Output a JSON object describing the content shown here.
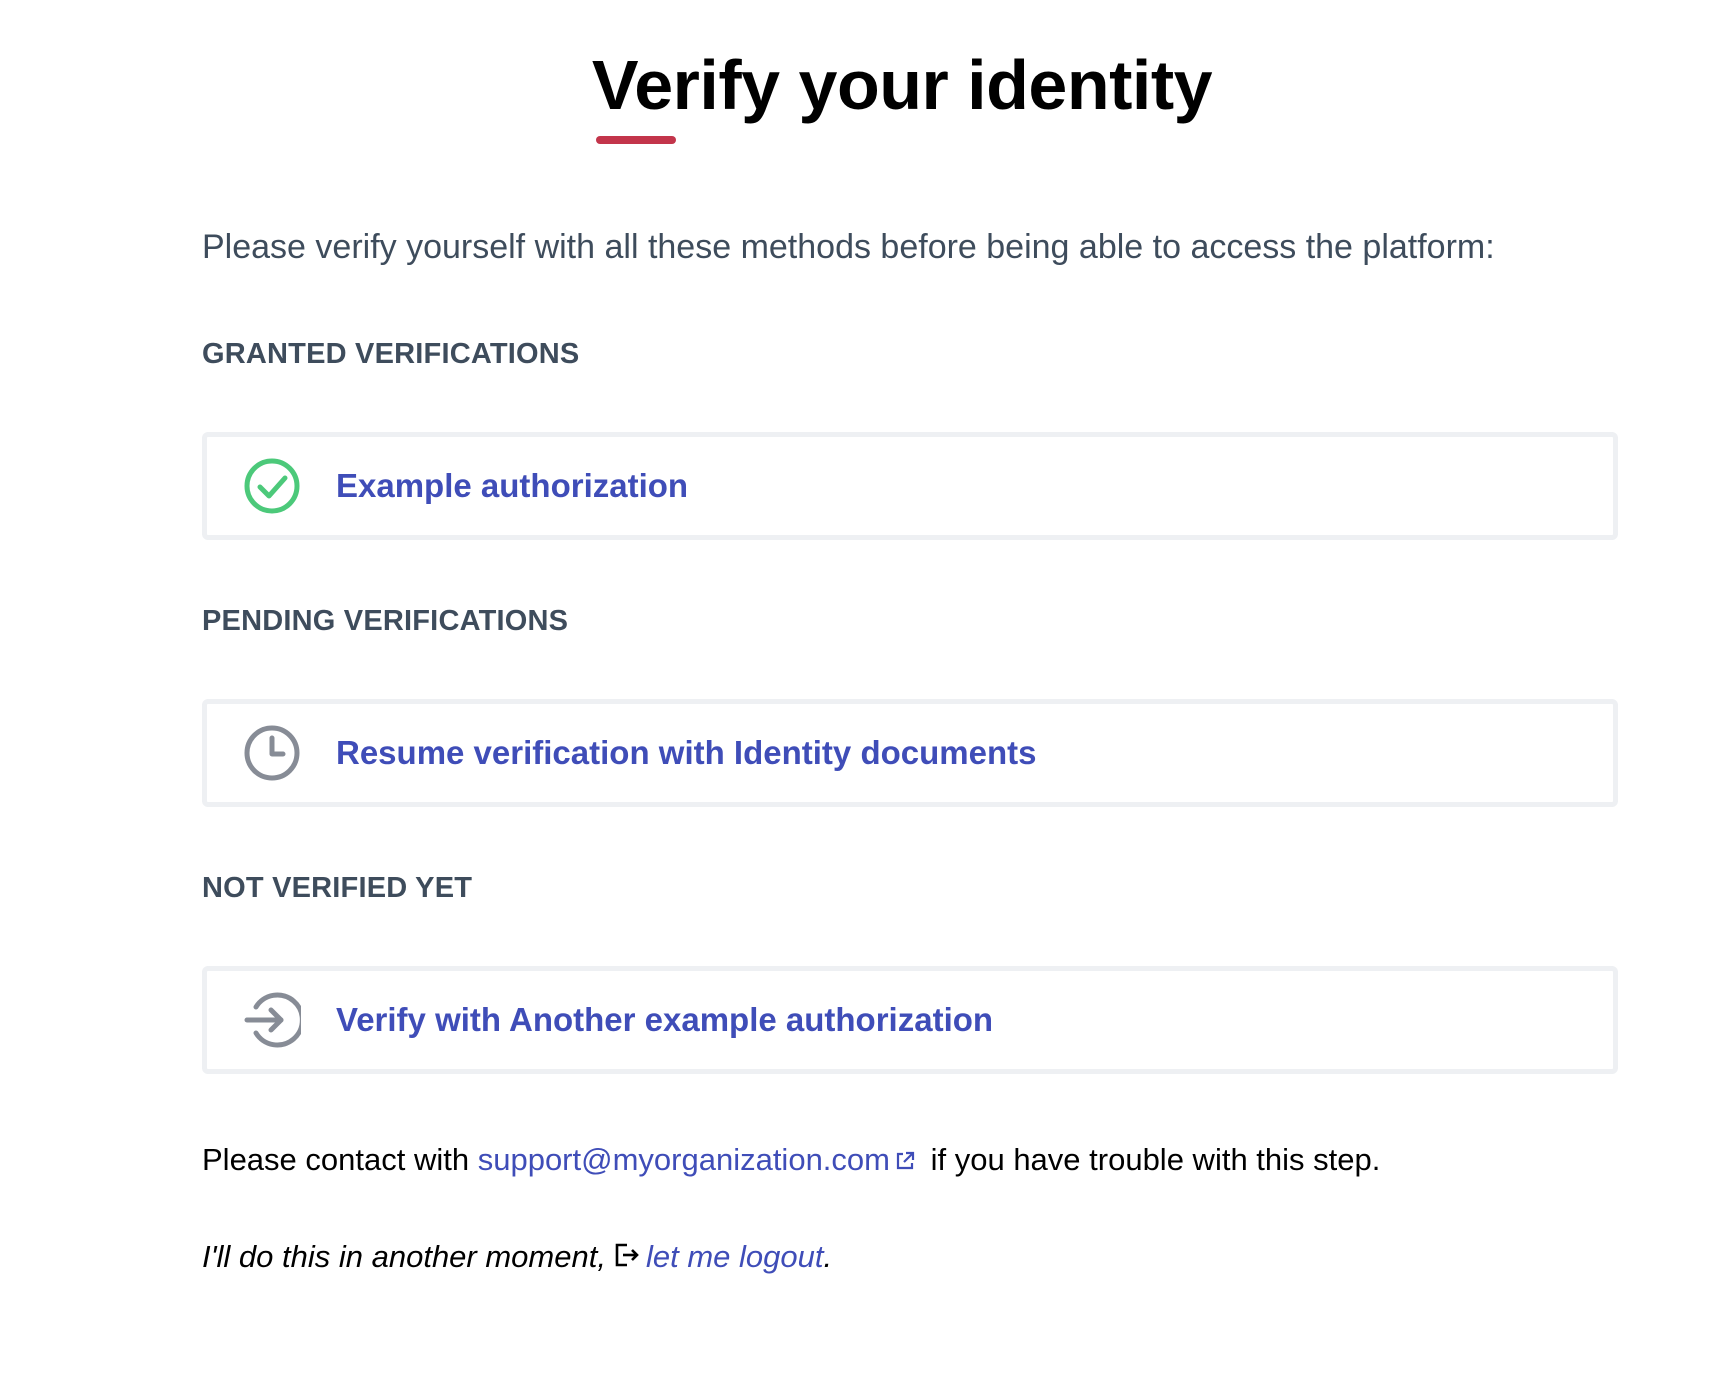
{
  "header": {
    "title": "Verify your identity",
    "accent_color": "#c3354b"
  },
  "intro": "Please verify yourself with all these methods before being able to access the platform:",
  "sections": {
    "granted": {
      "heading": "GRANTED VERIFICATIONS",
      "items": [
        {
          "label": "Example authorization",
          "icon": "check-circle-icon",
          "icon_color": "#4cc97a"
        }
      ]
    },
    "pending": {
      "heading": "PENDING VERIFICATIONS",
      "items": [
        {
          "label": "Resume verification with Identity documents",
          "icon": "clock-icon",
          "icon_color": "#878c96"
        }
      ]
    },
    "not_verified": {
      "heading": "NOT VERIFIED YET",
      "items": [
        {
          "label": "Verify with Another example authorization",
          "icon": "login-icon",
          "icon_color": "#878c96"
        }
      ]
    }
  },
  "contact": {
    "prefix": "Please contact with",
    "email": "support@myorganization.com",
    "suffix": "if you have trouble with this step."
  },
  "logout": {
    "prefix": "I'll do this in another moment,",
    "link_text": "let me logout",
    "suffix": "."
  },
  "colors": {
    "link": "#3f4db8",
    "text": "#3e4c5c",
    "card_border": "#eef0f3"
  }
}
